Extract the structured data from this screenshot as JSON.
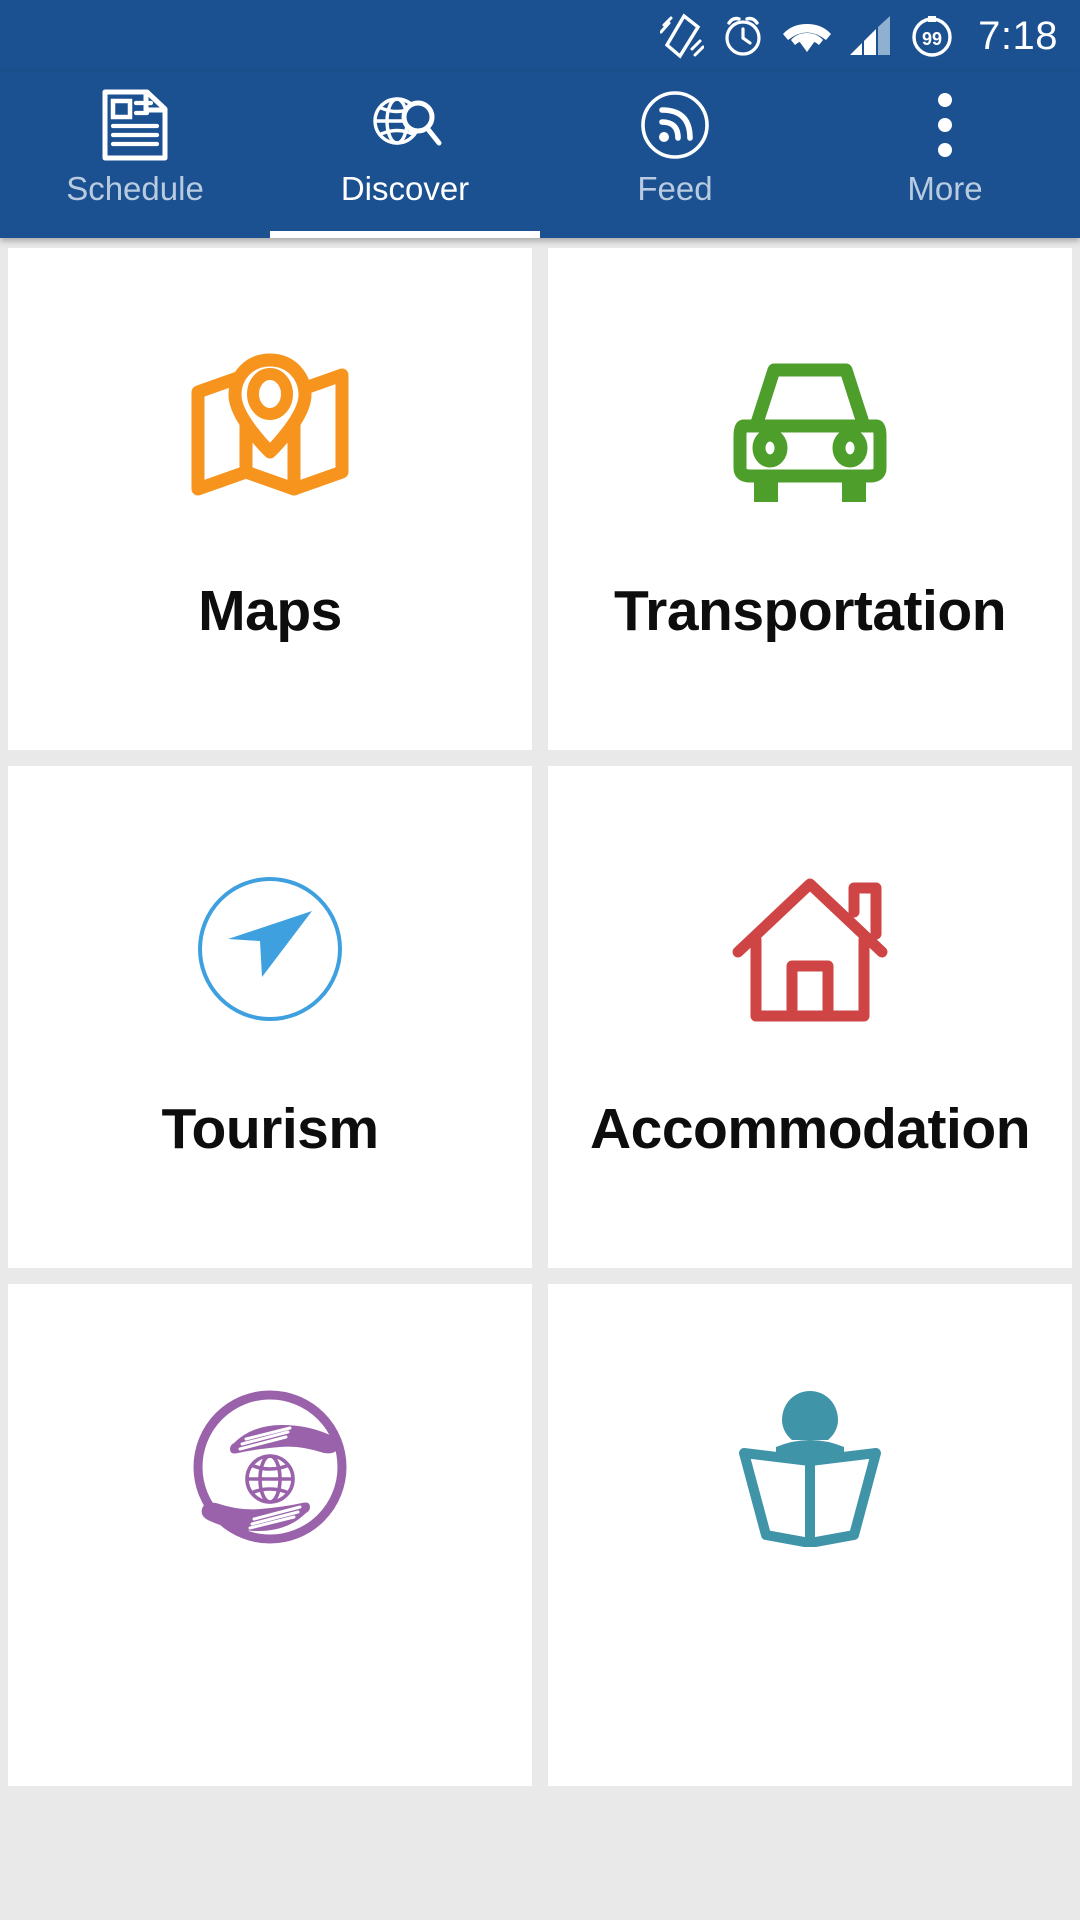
{
  "status_bar": {
    "time": "7:18",
    "battery_level": "99",
    "icons": [
      "vibrate-icon",
      "alarm-clock-icon",
      "wifi-icon",
      "cellular-signal-icon",
      "battery-icon"
    ]
  },
  "theme": {
    "primary_blue": "#1b5190",
    "page_background": "#e9e9e9",
    "card_background": "#ffffff",
    "tab_label_inactive": "#b9cbe0",
    "tab_label_active": "#ffffff"
  },
  "tabs": [
    {
      "label": "Schedule",
      "icon": "news-document-icon",
      "active": false
    },
    {
      "label": "Discover",
      "icon": "globe-search-icon",
      "active": true
    },
    {
      "label": "Feed",
      "icon": "rss-feed-icon",
      "active": false
    },
    {
      "label": "More",
      "icon": "overflow-menu-icon",
      "active": false
    }
  ],
  "grid": {
    "items": [
      {
        "label": "Maps",
        "icon": "folded-map-pin-icon",
        "color": "#f7941e"
      },
      {
        "label": "Transportation",
        "icon": "car-front-icon",
        "color": "#4e9e2b"
      },
      {
        "label": "Tourism",
        "icon": "compass-arrow-icon",
        "color": "#3fa0e0"
      },
      {
        "label": "Accommodation",
        "icon": "house-icon",
        "color": "#cf4444"
      },
      {
        "label": "",
        "icon": "hands-globe-icon",
        "color": "#9a62ab"
      },
      {
        "label": "",
        "icon": "person-reading-book-icon",
        "color": "#3f94a8"
      }
    ]
  }
}
